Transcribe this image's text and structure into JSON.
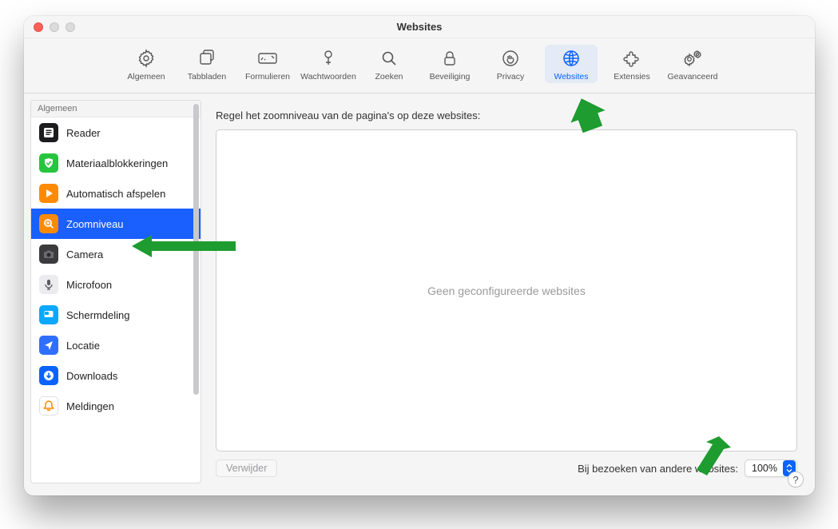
{
  "window": {
    "title": "Websites"
  },
  "toolbar": {
    "items": [
      {
        "label": "Algemeen"
      },
      {
        "label": "Tabbladen"
      },
      {
        "label": "Formulieren"
      },
      {
        "label": "Wachtwoorden"
      },
      {
        "label": "Zoeken"
      },
      {
        "label": "Beveiliging"
      },
      {
        "label": "Privacy"
      },
      {
        "label": "Websites"
      },
      {
        "label": "Extensies"
      },
      {
        "label": "Geavanceerd"
      }
    ],
    "selected_index": 7
  },
  "sidebar": {
    "section_header": "Algemeen",
    "selected_index": 3,
    "items": [
      {
        "label": "Reader",
        "icon": "reader-icon",
        "bg": "#1c1c1e"
      },
      {
        "label": "Materiaalblokkeringen",
        "icon": "shield-icon",
        "bg": "#27c440"
      },
      {
        "label": "Automatisch afspelen",
        "icon": "play-icon",
        "bg": "#ff8a00"
      },
      {
        "label": "Zoomniveau",
        "icon": "zoom-icon",
        "bg": "#ff8a00"
      },
      {
        "label": "Camera",
        "icon": "camera-icon",
        "bg": "#3b3b3d"
      },
      {
        "label": "Microfoon",
        "icon": "microphone-icon",
        "bg": "#ececee"
      },
      {
        "label": "Schermdeling",
        "icon": "screenshare-icon",
        "bg": "#0aa8ff"
      },
      {
        "label": "Locatie",
        "icon": "location-icon",
        "bg": "#2f6fff"
      },
      {
        "label": "Downloads",
        "icon": "download-icon",
        "bg": "#0a63ff"
      },
      {
        "label": "Meldingen",
        "icon": "bell-icon",
        "bg": "#ffffff"
      }
    ]
  },
  "main": {
    "header": "Regel het zoomniveau van de pagina's op deze websites:",
    "empty_text": "Geen geconfigureerde websites",
    "remove_button": "Verwijder",
    "other_sites_label": "Bij bezoeken van andere websites:",
    "zoom_value": "100%"
  },
  "help_glyph": "?"
}
